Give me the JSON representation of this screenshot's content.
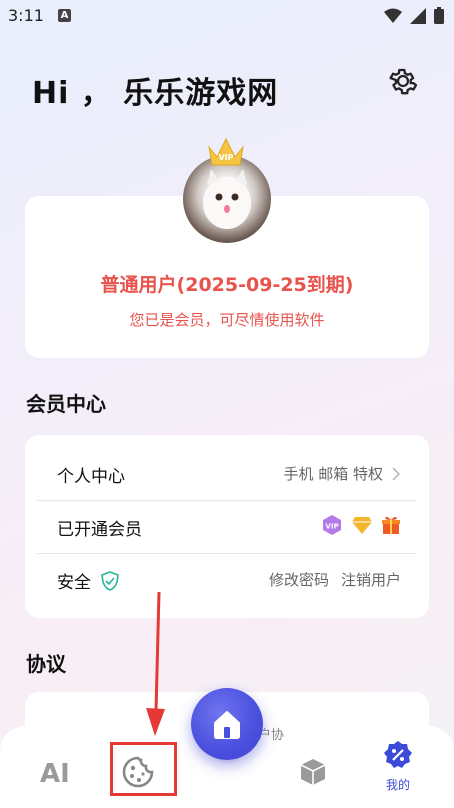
{
  "status_bar": {
    "time": "3:11",
    "notif_letter": "A"
  },
  "header": {
    "greeting": "Hi ， 乐乐游戏网"
  },
  "profile": {
    "level_text": "普通用户(2025-09-25到期)",
    "sub_text": "您已是会员，可尽情使用软件",
    "crown_badge": "VIP"
  },
  "sections": {
    "member_center": "会员中心",
    "agreement": "协议"
  },
  "member_rows": [
    {
      "label": "个人中心",
      "right": "手机 邮箱 特权"
    },
    {
      "label": "已开通会员",
      "right": ""
    },
    {
      "label": "安全",
      "right_a": "修改密码",
      "right_b": "注销用户"
    }
  ],
  "agreement_peek": "户协",
  "tabbar": {
    "ai_label": "AI",
    "mine_label": "我的"
  },
  "colors": {
    "accent": "#3b4bd8",
    "danger": "#e8534d",
    "fab": "#4a4fdd"
  },
  "icons": {
    "settings": "gear-icon",
    "game": "cookie-icon",
    "box": "box-icon",
    "mine": "percent-badge-icon",
    "home": "home-icon",
    "shield": "shield-check-icon"
  }
}
